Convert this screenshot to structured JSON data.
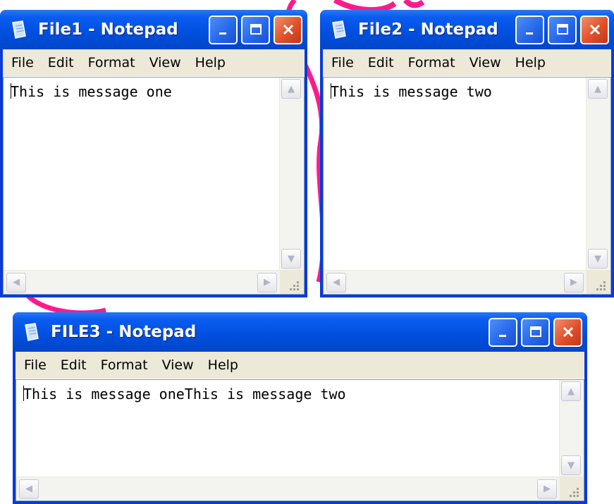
{
  "windows": [
    {
      "title": "File1 - Notepad",
      "menu": [
        "File",
        "Edit",
        "Format",
        "View",
        "Help"
      ],
      "content": "This is message one"
    },
    {
      "title": "File2 - Notepad",
      "menu": [
        "File",
        "Edit",
        "Format",
        "View",
        "Help"
      ],
      "content": "This is message two"
    },
    {
      "title": "FILE3 - Notepad",
      "menu": [
        "File",
        "Edit",
        "Format",
        "View",
        "Help"
      ],
      "content": "This is message oneThis is message two"
    }
  ],
  "icons": {
    "app": "notepad-icon",
    "minimize": "minimize-icon",
    "maximize": "maximize-icon",
    "close": "close-icon",
    "scroll_up": "scroll-up-arrow-icon",
    "scroll_down": "scroll-down-arrow-icon",
    "scroll_left": "scroll-left-arrow-icon",
    "scroll_right": "scroll-right-arrow-icon",
    "grip": "size-grip-icon"
  },
  "colors": {
    "titlebar": "#0150e0",
    "close_button": "#e0502a",
    "annotation_stroke": "#ff1a8c",
    "menubar": "#ece9d8"
  }
}
